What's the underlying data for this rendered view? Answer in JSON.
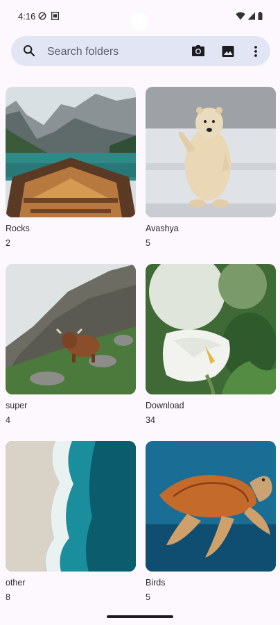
{
  "status_bar": {
    "time": "4:16",
    "icons": [
      "do-not-disturb-icon",
      "notification-icon",
      "wifi-icon",
      "cellular-icon",
      "battery-icon"
    ]
  },
  "search": {
    "placeholder": "Search folders",
    "actions": [
      "camera-icon",
      "image-icon",
      "more-vert-icon"
    ]
  },
  "folders": [
    {
      "name": "Rocks",
      "count": "2",
      "image": "mountain-lake-boat"
    },
    {
      "name": "Avashya",
      "count": "5",
      "image": "polar-bear"
    },
    {
      "name": "super",
      "count": "4",
      "image": "highland-cow-on-mountain"
    },
    {
      "name": "Download",
      "count": "34",
      "image": "calla-lily-flower"
    },
    {
      "name": "other",
      "count": "8",
      "image": "aerial-beach-waves"
    },
    {
      "name": "Birds",
      "count": "5",
      "image": "sea-turtle"
    }
  ],
  "colors": {
    "background": "#fdf8fd",
    "search_bar": "#e2e6f4"
  }
}
